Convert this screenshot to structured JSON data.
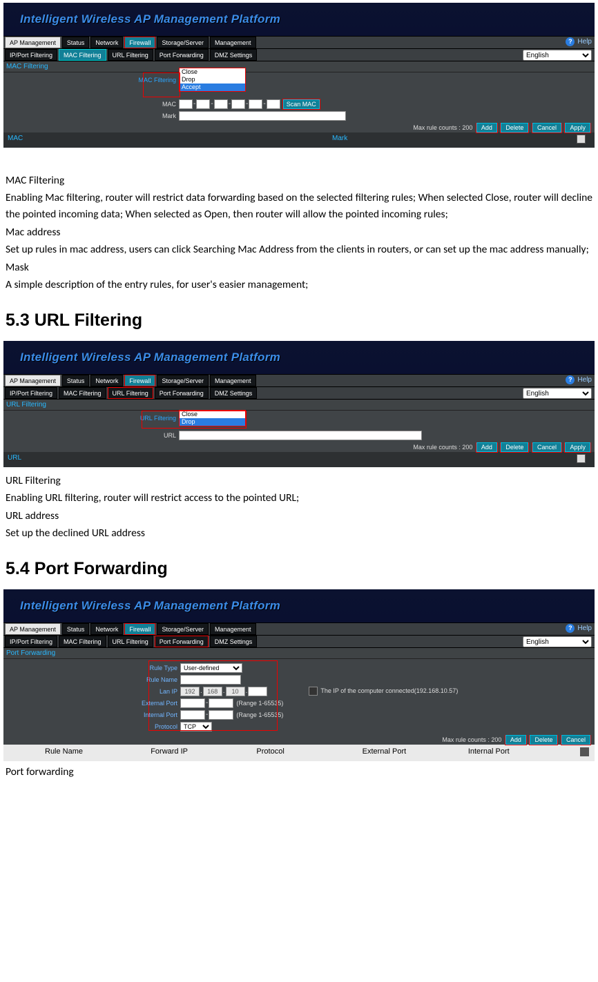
{
  "common": {
    "banner_title": "Intelligent Wireless AP Management Platform",
    "main_tabs": {
      "ap": "AP Management",
      "status": "Status",
      "network": "Network",
      "firewall": "Firewall",
      "storage": "Storage/Server",
      "mgmt": "Management"
    },
    "help": "Help",
    "lang": "English",
    "actions": {
      "add": "Add",
      "delete": "Delete",
      "cancel": "Cancel",
      "apply": "Apply"
    },
    "max_rule": "Max rule counts : 200"
  },
  "mac_shot": {
    "sub_tabs": {
      "ipport": "IP/Port Filtering",
      "mac": "MAC Filtering",
      "url": "URL Filtering",
      "pf": "Port Forwarding",
      "dmz": "DMZ Settings"
    },
    "panel": "MAC Filtering",
    "row_label": "MAC Filtering",
    "drop_opts": {
      "close": "Close",
      "drop": "Drop",
      "accept": "Accept"
    },
    "mac_label": "MAC",
    "scan_btn": "Scan MAC",
    "mark_label": "Mark",
    "col_mac": "MAC",
    "col_mark": "Mark"
  },
  "mac_text": {
    "t1": "MAC Filtering",
    "p1": "Enabling Mac filtering, router will restrict data forwarding based on the selected filtering rules; When selected Close,   router will decline the pointed incoming data; When selected as Open, then router will allow the pointed incoming rules;",
    "t2": "Mac address",
    "p2": "Set up rules in mac address, users can click Searching Mac Address from the clients in routers, or can set up the mac address manually;",
    "t3": "Mask",
    "p3": "A simple description of the entry rules, for user's easier management;"
  },
  "url_section_title": "5.3 URL Filtering",
  "url_shot": {
    "sub_tabs": {
      "ipport": "IP/Port Filtering",
      "mac": "MAC Filtering",
      "url": "URL Filtering",
      "pf": "Port Forwarding",
      "dmz": "DMZ Settings"
    },
    "panel": "URL Filtering",
    "row_label": "URL Filtering",
    "drop_opts": {
      "close": "Close",
      "drop": "Drop"
    },
    "url_label": "URL",
    "col_url": "URL"
  },
  "url_text": {
    "t1": "URL Filtering",
    "p1": "Enabling URL filtering, router will restrict access to the pointed URL;",
    "t2": "URL address",
    "p2": "Set up the declined URL address"
  },
  "pf_section_title": "5.4   Port Forwarding",
  "pf_shot": {
    "sub_tabs": {
      "ipport": "IP/Port Filtering",
      "mac": "MAC Filtering",
      "url": "URL Filtering",
      "pf": "Port Forwarding",
      "dmz": "DMZ Settings"
    },
    "panel": "Port Forwarding",
    "rule_type_lbl": "Rule Type",
    "rule_type_val": "User-defined",
    "rule_name_lbl": "Rule Name",
    "lanip_lbl": "Lan IP",
    "lanip_oct": [
      "192",
      "168",
      "10",
      ""
    ],
    "ip_note": "The IP of the computer connected(192.168.10.57)",
    "ext_port_lbl": "External Port",
    "range": "(Range 1-65535)",
    "int_port_lbl": "Internal Port",
    "proto_lbl": "Protocol",
    "proto_val": "TCP",
    "cols": {
      "rn": "Rule Name",
      "fip": "Forward IP",
      "proto": "Protocol",
      "ep": "External Port",
      "ip": "Internal Port"
    }
  },
  "pf_text": {
    "t1": "Port forwarding"
  }
}
